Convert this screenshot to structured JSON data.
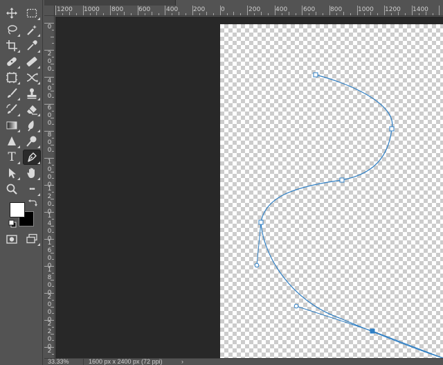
{
  "toolbar": {
    "tools": [
      {
        "name": "move-tool",
        "icon": "move-icon"
      },
      {
        "name": "marquee-tool",
        "icon": "rect-marquee-icon"
      },
      {
        "name": "lasso-tool",
        "icon": "lasso-icon"
      },
      {
        "name": "magic-wand-tool",
        "icon": "magic-wand-icon"
      },
      {
        "name": "crop-tool",
        "icon": "crop-icon"
      },
      {
        "name": "eyedropper-tool",
        "icon": "eyedropper-icon"
      },
      {
        "name": "healing-tool",
        "icon": "bandage-icon"
      },
      {
        "name": "content-aware-tool",
        "icon": "patch-icon"
      },
      {
        "name": "frame-tool",
        "icon": "frame-icon"
      },
      {
        "name": "shuffle-tool",
        "icon": "shuffle-icon"
      },
      {
        "name": "brush-tool",
        "icon": "brush-icon"
      },
      {
        "name": "stamp-tool",
        "icon": "stamp-icon"
      },
      {
        "name": "history-brush-tool",
        "icon": "history-brush-icon"
      },
      {
        "name": "eraser-tool",
        "icon": "eraser-icon"
      },
      {
        "name": "gradient-tool",
        "icon": "gradient-icon"
      },
      {
        "name": "blur-tool",
        "icon": "drop-icon"
      },
      {
        "name": "sharpen-tool",
        "icon": "triangle-icon"
      },
      {
        "name": "dodge-tool",
        "icon": "dodge-icon"
      },
      {
        "name": "type-tool",
        "icon": "type-icon",
        "glyph": "T"
      },
      {
        "name": "pen-tool",
        "icon": "pen-icon",
        "active": true
      },
      {
        "name": "path-selection-tool",
        "icon": "arrow-icon"
      },
      {
        "name": "hand-tool",
        "icon": "hand-icon"
      },
      {
        "name": "zoom-tool",
        "icon": "magnifier-icon"
      },
      {
        "name": "more-tools",
        "icon": "ellipsis-icon",
        "glyph": "•••"
      },
      {
        "name": "quick-mask-mode",
        "icon": "quick-mask-icon"
      },
      {
        "name": "screen-mode",
        "icon": "screen-mode-icon"
      }
    ],
    "foreground_color": "#ffffff",
    "background_color": "#000000"
  },
  "rulers": {
    "top_labels": [
      "1200",
      "1000",
      "800",
      "600",
      "400",
      "200",
      "0",
      "200",
      "400",
      "600",
      "800",
      "1000",
      "1200",
      "1400"
    ],
    "left_labels": [
      "0",
      "200",
      "400",
      "600",
      "800",
      "1000",
      "1200",
      "1400",
      "1600",
      "1800",
      "2000",
      "2200",
      "2"
    ]
  },
  "canvas": {
    "path_color": "#2f7fc4",
    "anchor_fill": "#ffffff",
    "selected_anchor_fill": "#2f7fc4"
  },
  "statusbar": {
    "zoom": "33.33%",
    "doc_info": "1600 px x 2400 px (72 ppi)",
    "arrow": "›"
  }
}
